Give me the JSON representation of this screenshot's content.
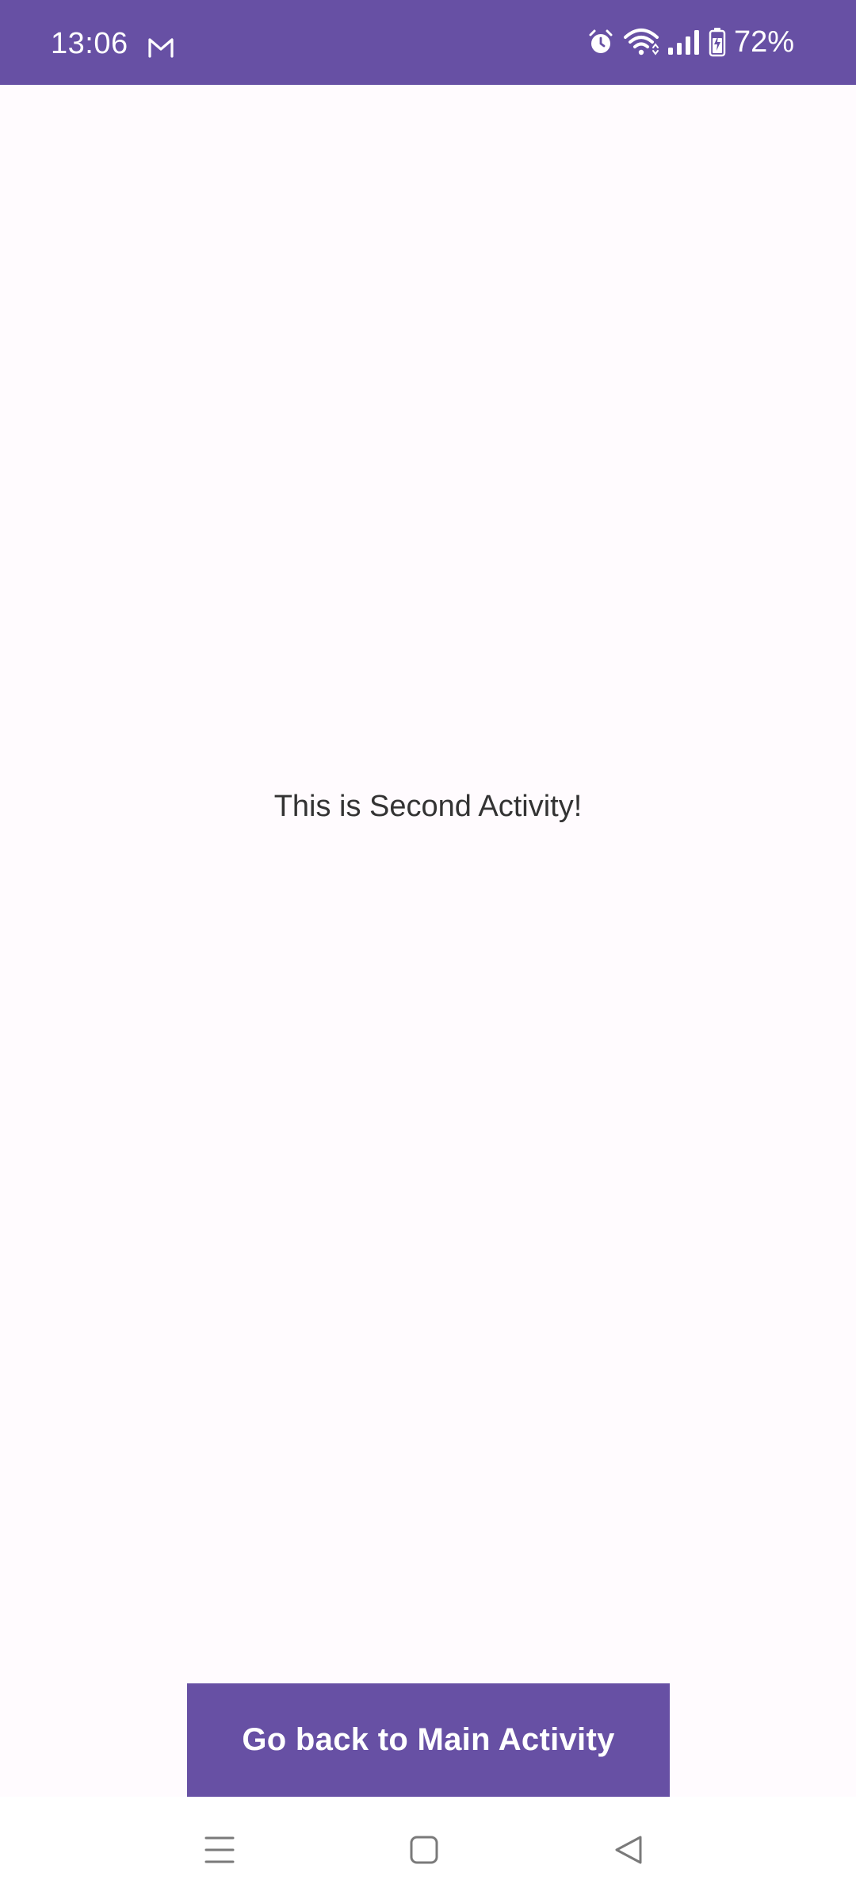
{
  "status_bar": {
    "time": "13:06",
    "battery": "72%",
    "icons": [
      "gmail-icon",
      "alarm-icon",
      "wifi-icon",
      "signal-icon",
      "battery-charging-icon"
    ],
    "background_color": "#6750a4"
  },
  "main": {
    "message": "This is Second Activity!"
  },
  "button": {
    "label": "Go back to Main Activity",
    "color": "#6750a4"
  },
  "nav_bar": {
    "icons": [
      "recents-icon",
      "home-icon",
      "back-icon"
    ]
  }
}
